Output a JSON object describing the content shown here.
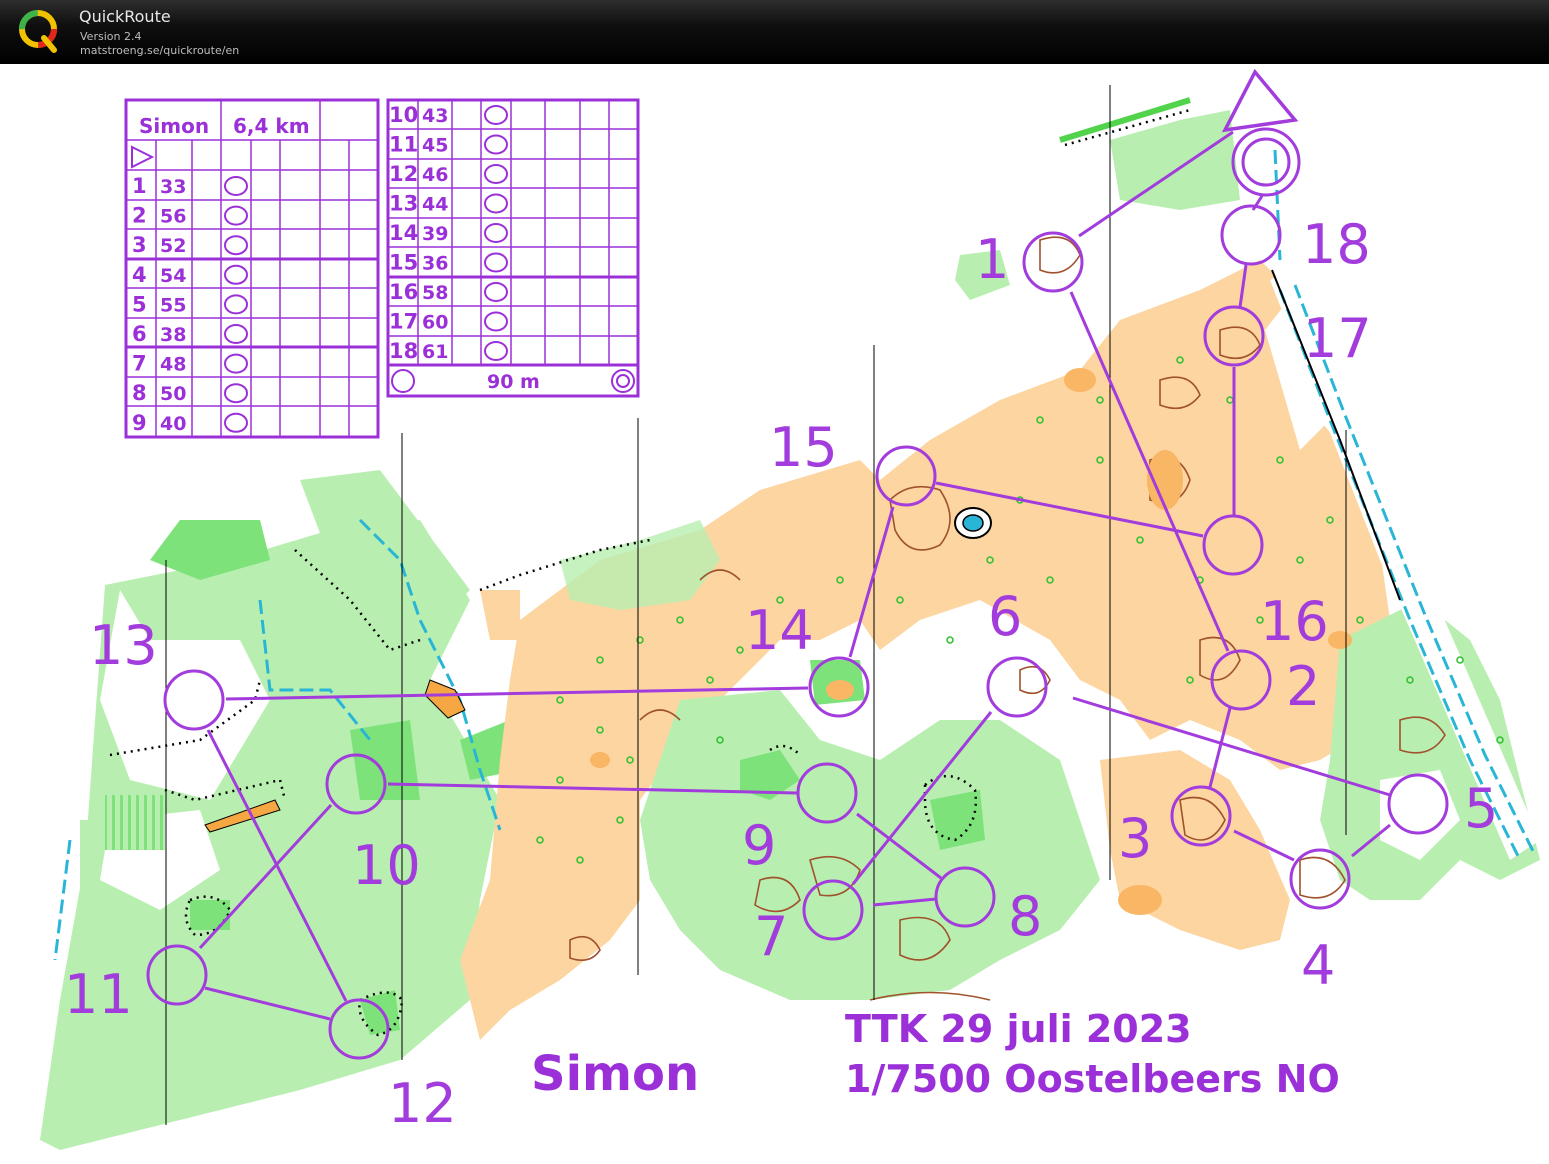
{
  "window": {
    "app_name": "QuickRoute",
    "version": "Version 2.4",
    "url": "matstroeng.se/quickroute/en",
    "logo_letter": "Q"
  },
  "course": {
    "runner": "Simon",
    "length": "6,4 km",
    "event_title": "TTK 29 juli 2023",
    "scale_area": "1/7500 Oostelbeers NO",
    "map_label": "Simon",
    "finish_distance": "90 m"
  },
  "description_rows_left": [
    {
      "n": "1",
      "code": "33"
    },
    {
      "n": "2",
      "code": "56"
    },
    {
      "n": "3",
      "code": "52"
    },
    {
      "n": "4",
      "code": "54"
    },
    {
      "n": "5",
      "code": "55"
    },
    {
      "n": "6",
      "code": "38"
    },
    {
      "n": "7",
      "code": "48"
    },
    {
      "n": "8",
      "code": "50"
    },
    {
      "n": "9",
      "code": "40"
    }
  ],
  "description_rows_right": [
    {
      "n": "10",
      "code": "43"
    },
    {
      "n": "11",
      "code": "45"
    },
    {
      "n": "12",
      "code": "46"
    },
    {
      "n": "13",
      "code": "44"
    },
    {
      "n": "14",
      "code": "39"
    },
    {
      "n": "15",
      "code": "36"
    },
    {
      "n": "16",
      "code": "58"
    },
    {
      "n": "17",
      "code": "60"
    },
    {
      "n": "18",
      "code": "61"
    }
  ],
  "controls": [
    "1",
    "2",
    "3",
    "4",
    "5",
    "6",
    "7",
    "8",
    "9",
    "10",
    "11",
    "12",
    "13",
    "14",
    "15",
    "16",
    "17",
    "18"
  ],
  "colors": {
    "course": "#a23cdc",
    "open_land": "#fcd5a0",
    "forest_green": "#b8efb0",
    "dense_green": "#7de27a",
    "water": "#29b6d6",
    "contour": "#a0522d"
  }
}
